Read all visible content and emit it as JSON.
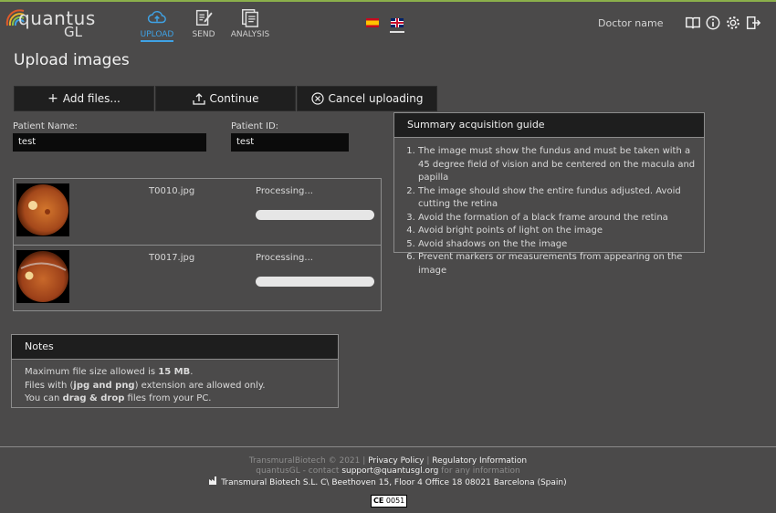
{
  "app": {
    "logo_text": "quantus",
    "logo_sub": "GL",
    "nav": [
      {
        "label": "UPLOAD",
        "icon": "cloud-upload-icon",
        "active": true
      },
      {
        "label": "SEND",
        "icon": "edit-document-icon",
        "active": false
      },
      {
        "label": "ANALYSIS",
        "icon": "document-list-icon",
        "active": false
      }
    ],
    "doctor_name": "Doctor name"
  },
  "page": {
    "title": "Upload images",
    "buttons": {
      "add_files": "Add files...",
      "continue": "Continue",
      "cancel_uploading": "Cancel uploading"
    },
    "patient_name_label": "Patient Name:",
    "patient_name_value": "test",
    "patient_id_label": "Patient ID:",
    "patient_id_value": "test"
  },
  "files": [
    {
      "name": "T0010.jpg",
      "status": "Processing..."
    },
    {
      "name": "T0017.jpg",
      "status": "Processing..."
    }
  ],
  "guide": {
    "title": "Summary acquisition guide",
    "items": [
      "The image must show the fundus and must be taken with a 45 degree field of vision and be centered on the macula and papilla",
      "The image should show the entire fundus adjusted. Avoid cutting the retina",
      "Avoid the formation of a black frame around the retina",
      "Avoid bright points of light on the image",
      "Avoid shadows on the the image",
      "Prevent markers or measurements from appearing on the image"
    ]
  },
  "notes": {
    "title": "Notes",
    "line1_prefix": "Maximum file size allowed is ",
    "line1_bold": "15 MB",
    "line1_suffix": ".",
    "line2_prefix": "Files with (",
    "line2_bold": "jpg and png",
    "line2_suffix": ") extension are allowed only.",
    "line3_prefix": "You can ",
    "line3_bold": "drag & drop",
    "line3_suffix": " files from your PC."
  },
  "footer": {
    "copyright": "TransmuralBiotech © 2021 |",
    "privacy": "Privacy Policy",
    "sep": "|",
    "regulatory": "Regulatory Information",
    "contact_prefix": "quantusGL - contact",
    "contact_email": "support@quantusgl.org",
    "contact_suffix": "for any information",
    "address": "Transmural Biotech S.L. C\\ Beethoven 15, Floor 4 Office 18 08021 Barcelona (Spain)",
    "ce": "0051"
  },
  "colors": {
    "background": "#4b4a4a",
    "accent": "#3fa2e5",
    "panel_header": "#1e1e1e"
  }
}
